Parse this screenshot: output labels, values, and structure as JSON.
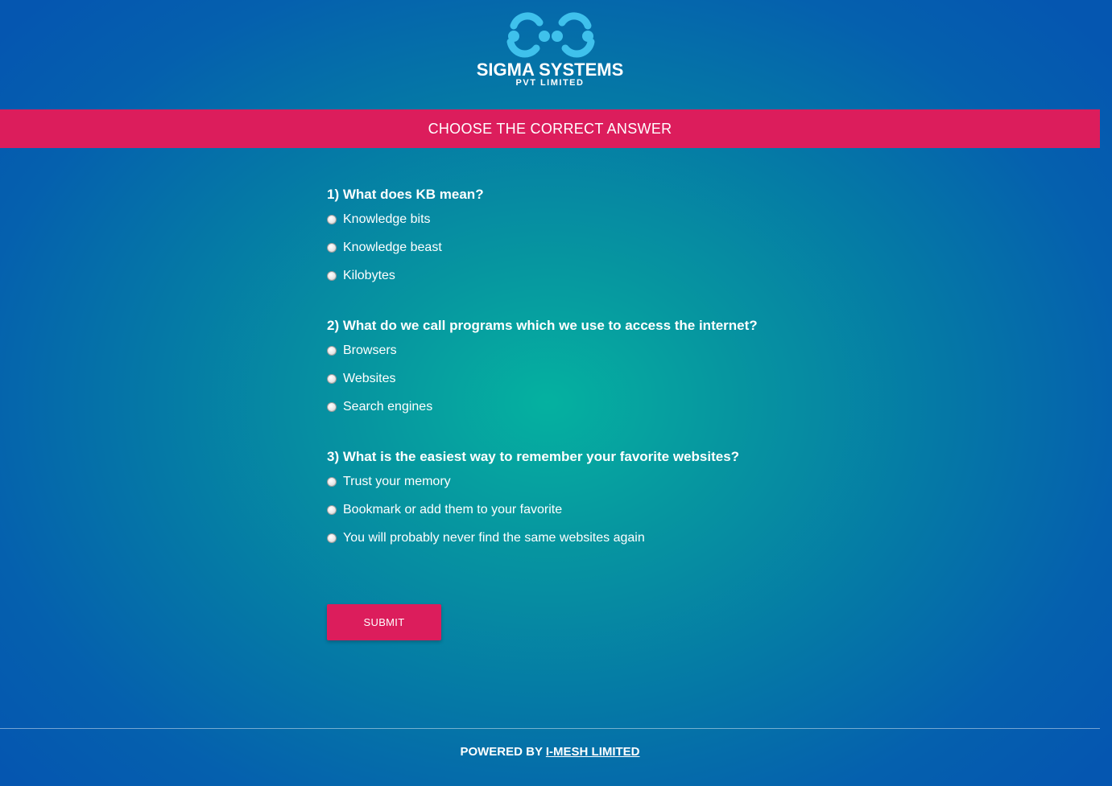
{
  "brand": {
    "name": "SIGMA SYSTEMS",
    "subtitle": "PVT LIMITED",
    "logo_icon": "sigma-systems-logo-icon",
    "logo_color": "#3fc1ec"
  },
  "banner": {
    "title": "CHOOSE THE CORRECT ANSWER",
    "color": "#dc1d5c"
  },
  "questions": [
    {
      "text": "1) What does KB mean?",
      "options": [
        "Knowledge bits",
        "Knowledge beast",
        "Kilobytes"
      ]
    },
    {
      "text": "2) What do we call programs which we use to access the internet?",
      "options": [
        "Browsers",
        "Websites",
        "Search engines"
      ]
    },
    {
      "text": "3) What is the easiest way to remember your favorite websites?",
      "options": [
        "Trust your memory",
        "Bookmark or add them to your favorite",
        "You will probably never find the same websites again"
      ]
    }
  ],
  "submit_label": "SUBMIT",
  "footer": {
    "prefix": "POWERED BY ",
    "link_text": "I-MESH LIMITED"
  }
}
